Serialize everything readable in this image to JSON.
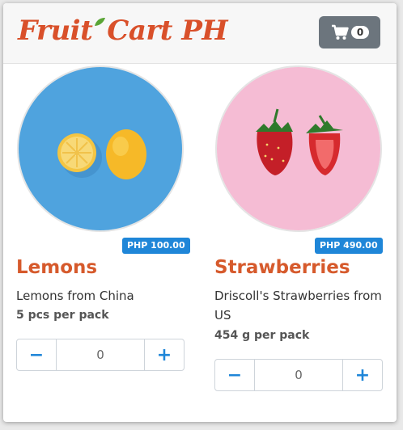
{
  "header": {
    "logo_text": "Fruit Cart PH",
    "cart_count": "0",
    "cart_icon": "shopping-cart-icon"
  },
  "products": [
    {
      "name": "Lemons",
      "price": "PHP 100.00",
      "description": "Lemons from China",
      "pack": "5 pcs per pack",
      "quantity": "0",
      "image": "lemons-image"
    },
    {
      "name": "Strawberries",
      "price": "PHP 490.00",
      "description": "Driscoll's Strawberries from US",
      "pack": "454 g per pack",
      "quantity": "0",
      "image": "strawberries-image"
    }
  ],
  "controls": {
    "minus_label": "−",
    "plus_label": "+"
  },
  "colors": {
    "brand": "#d9502a",
    "accent": "#1f86d8",
    "cart_button": "#6c757d"
  }
}
